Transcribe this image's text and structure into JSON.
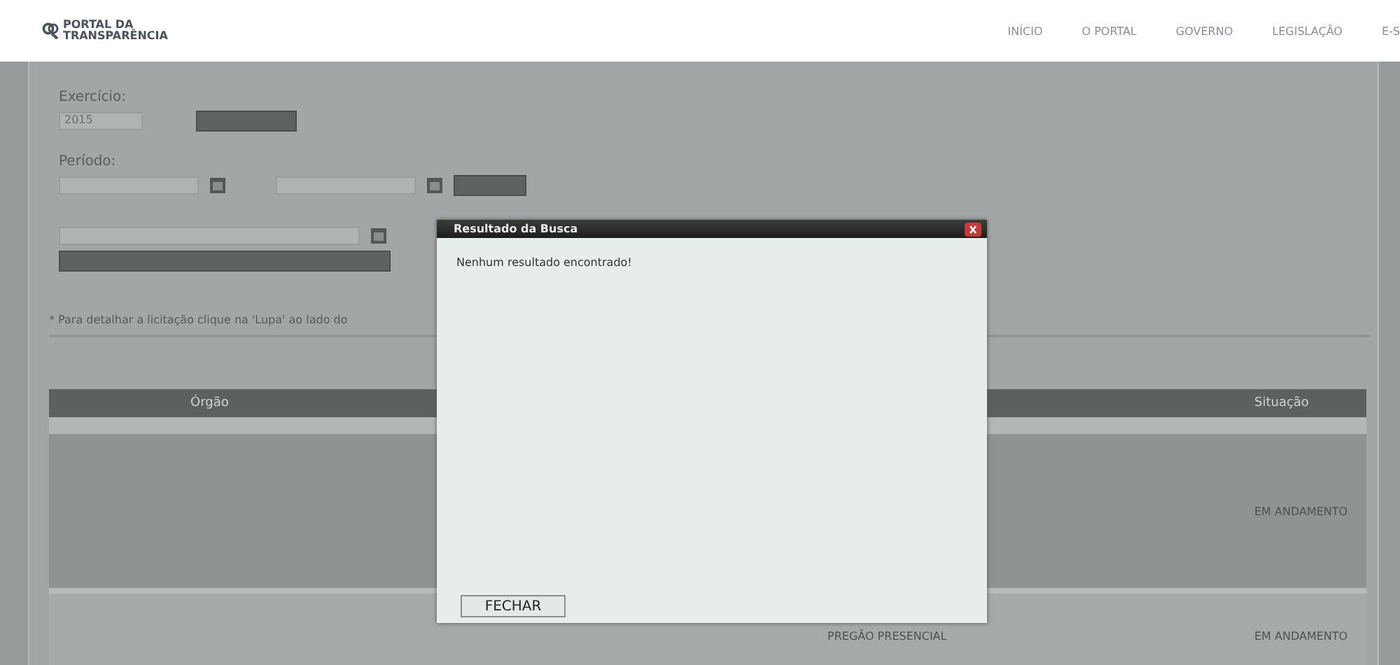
{
  "header": {
    "logo_lines": [
      "PORTAL DA",
      "TRANSPARÊNCIA"
    ],
    "nav": [
      "INÍCIO",
      "O PORTAL",
      "GOVERNO",
      "LEGISLAÇÃO",
      "E-S"
    ]
  },
  "form": {
    "exercicio_label": "Exercício:",
    "exercicio_value": "2015",
    "periodo_label": "Período:"
  },
  "note": "* Para detalhar a licitação clique na 'Lupa' ao lado do",
  "table": {
    "columns": [
      "Órgão",
      "Situação"
    ],
    "rows": [
      {
        "modality": "",
        "status": "EM ANDAMENTO"
      },
      {
        "modality": "PREGÃO PRESENCIAL",
        "status": "EM ANDAMENTO"
      }
    ]
  },
  "dialog": {
    "title": "Resultado da Busca",
    "message": "Nenhum resultado encontrado!",
    "button": "FECHAR"
  }
}
